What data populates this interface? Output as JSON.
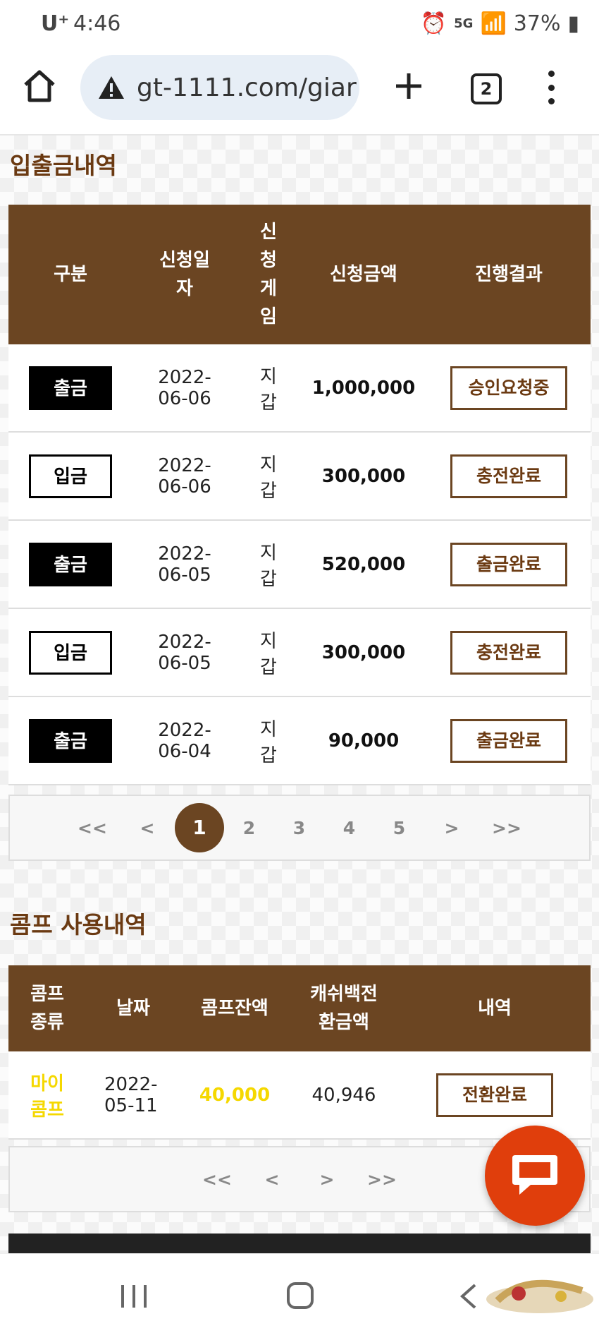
{
  "status_bar": {
    "carrier": "U⁺",
    "time": "4:46",
    "network": "5G",
    "battery": "37%"
  },
  "browser": {
    "url": "gt-1111.com/giar",
    "tab_count": "2"
  },
  "deposit_section": {
    "title": "입출금내역",
    "headers": {
      "type": "구분",
      "date": "신청일\n자",
      "game": "신\n청\n게\n임",
      "amount": "신청금액",
      "result": "진행결과"
    },
    "rows": [
      {
        "type": "출금",
        "kind": "out",
        "date": "2022-\n06-06",
        "game": "지\n갑",
        "amount": "1,000,000",
        "result": "승인요청중"
      },
      {
        "type": "입금",
        "kind": "in",
        "date": "2022-\n06-06",
        "game": "지\n갑",
        "amount": "300,000",
        "result": "충전완료"
      },
      {
        "type": "출금",
        "kind": "out",
        "date": "2022-\n06-05",
        "game": "지\n갑",
        "amount": "520,000",
        "result": "출금완료"
      },
      {
        "type": "입금",
        "kind": "in",
        "date": "2022-\n06-05",
        "game": "지\n갑",
        "amount": "300,000",
        "result": "충전완료"
      },
      {
        "type": "출금",
        "kind": "out",
        "date": "2022-\n06-04",
        "game": "지\n갑",
        "amount": "90,000",
        "result": "출금완료"
      }
    ],
    "pager": {
      "first": "<<",
      "prev": "<",
      "pages": [
        "1",
        "2",
        "3",
        "4",
        "5"
      ],
      "next": ">",
      "last": ">>",
      "current": "1"
    }
  },
  "comp_section": {
    "title": "콤프 사용내역",
    "headers": {
      "kind": "콤프\n종류",
      "date": "날짜",
      "balance": "콤프잔액",
      "cashback": "캐쉬백전\n환금액",
      "detail": "내역"
    },
    "rows": [
      {
        "kind": "마이\n콤프",
        "date": "2022-\n05-11",
        "balance": "40,000",
        "cashback": "40,946",
        "detail": "전환완료"
      }
    ],
    "pager": {
      "first": "<<",
      "prev": "<",
      "next": ">",
      "last": ">>"
    }
  },
  "colors": {
    "brown": "#6b4522",
    "title_brown": "#6b3a12",
    "yellow": "#f5d800",
    "chat": "#e03e0c"
  }
}
